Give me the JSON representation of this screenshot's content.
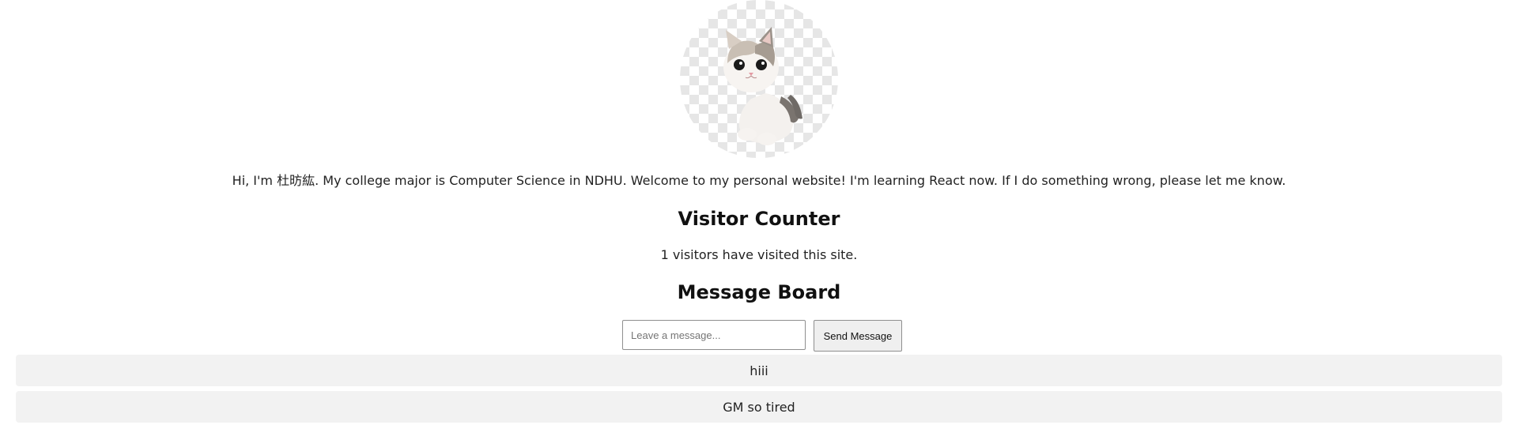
{
  "profile": {
    "intro": "Hi, I'm 杜昉紘. My college major is Computer Science in NDHU. Welcome to my personal website! I'm learning React now. If I do something wrong, please let me know.",
    "avatar_icon": "cat-avatar"
  },
  "visitor_counter": {
    "title": "Visitor Counter",
    "text": "1 visitors have visited this site."
  },
  "message_board": {
    "title": "Message Board",
    "input_placeholder": "Leave a message...",
    "input_value": "",
    "send_label": "Send Message",
    "messages": [
      {
        "text": "hiii"
      },
      {
        "text": "GM so tired"
      }
    ]
  }
}
